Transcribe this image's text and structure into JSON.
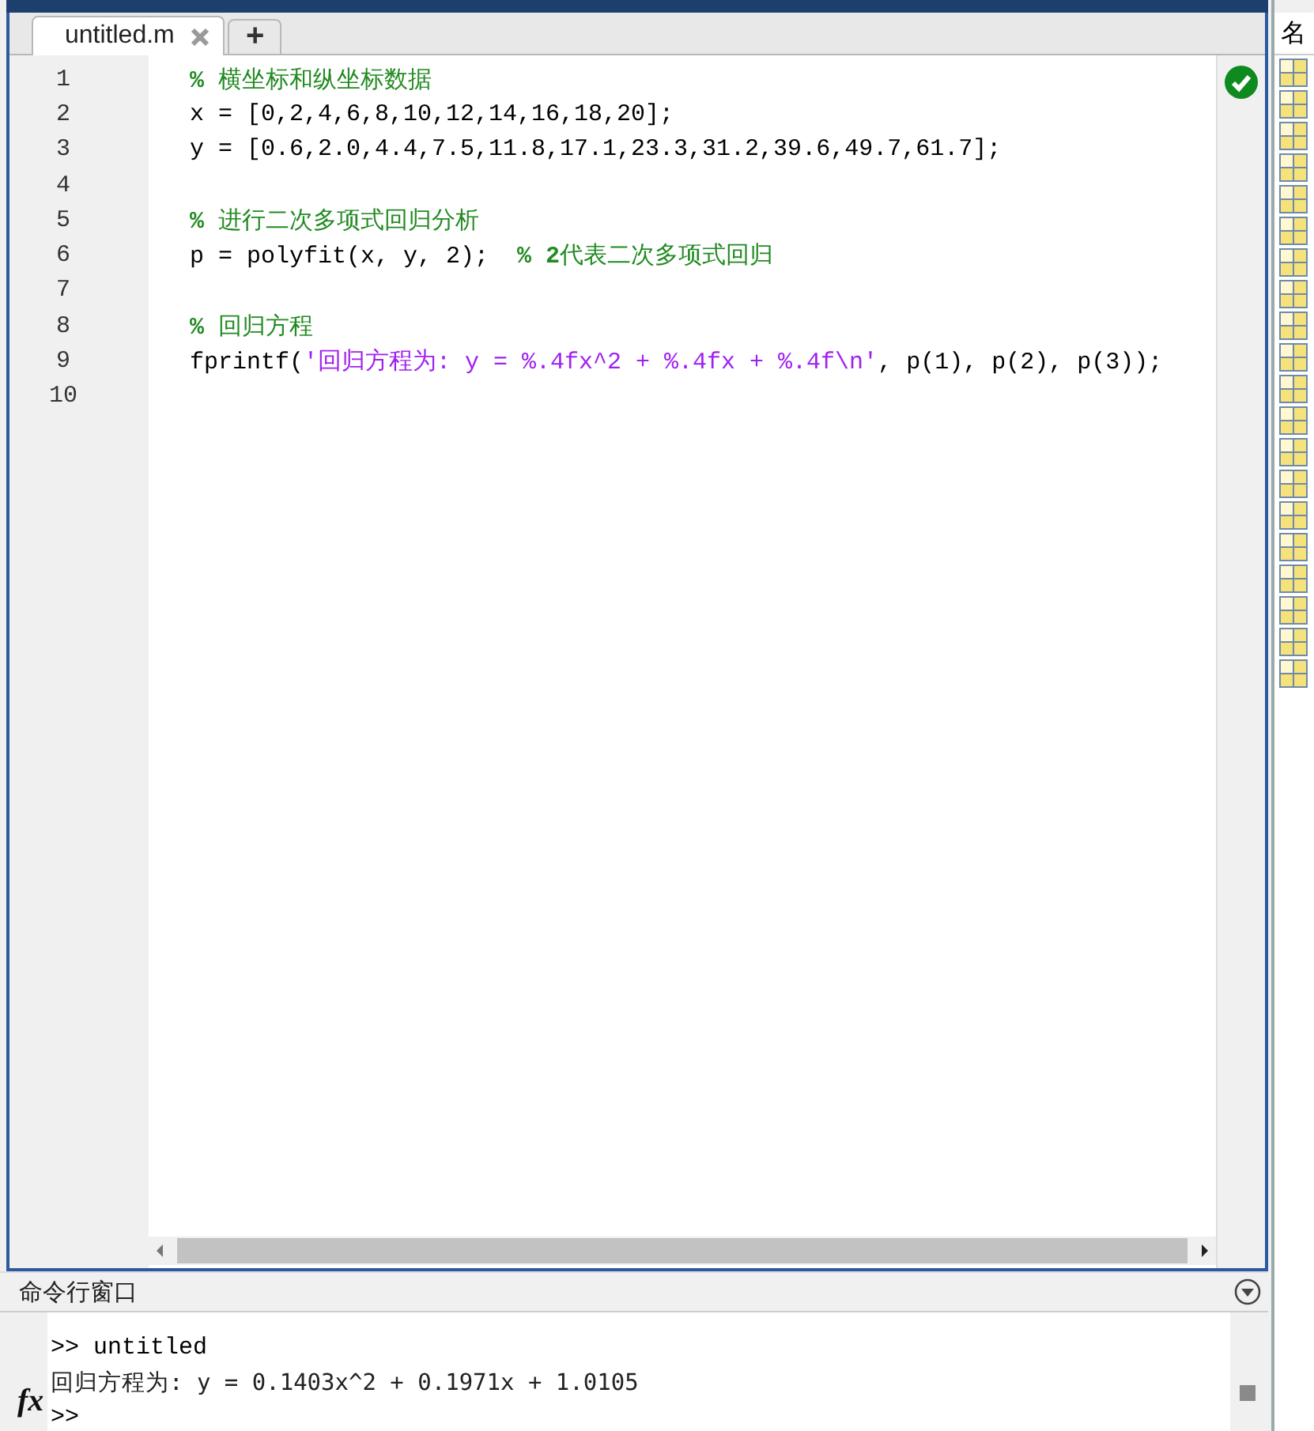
{
  "editor": {
    "tabs": [
      {
        "label": "untitled.m",
        "selected": true
      }
    ],
    "add_tab": "+",
    "no_issues": true,
    "lines": [
      {
        "number": "1",
        "tokens": [
          {
            "kind": "comment",
            "text": "**%** 横坐标和纵坐标数据"
          }
        ]
      },
      {
        "number": "2",
        "tokens": [
          {
            "kind": "code",
            "text": "x = [0,2,4,6,8,10,12,14,16,18,20];"
          }
        ]
      },
      {
        "number": "3",
        "tokens": [
          {
            "kind": "code",
            "text": "y = [0.6,2.0,4.4,7.5,11.8,17.1,23.3,31.2,39.6,49.7,61.7];"
          }
        ]
      },
      {
        "number": "4"
      },
      {
        "number": "5",
        "tokens": [
          {
            "kind": "comment",
            "text": "**%** 进行二次多项式回归分析"
          }
        ]
      },
      {
        "number": "6",
        "tokens": [
          {
            "kind": "code",
            "text": "p = polyfit(x, y, 2);  "
          },
          {
            "kind": "comment",
            "text": "**% 2**代表二次多项式回归"
          }
        ]
      },
      {
        "number": "7"
      },
      {
        "number": "8",
        "tokens": [
          {
            "kind": "comment",
            "text": "**%** 回归方程"
          }
        ]
      },
      {
        "number": "9",
        "tokens": [
          {
            "kind": "code",
            "text": "fprintf("
          },
          {
            "kind": "string",
            "text": "'回归方程为: y = %.4fx^2 + %.4fx + %.4f\\n'"
          },
          {
            "kind": "code",
            "text": ", p(1), p(2), p(3));"
          }
        ]
      },
      {
        "number": "10"
      }
    ]
  },
  "command_window": {
    "title": "命令行窗口",
    "fx_label": "fx",
    "lines": [
      {
        "kind": "input",
        "text": ">> untitled"
      },
      {
        "kind": "output",
        "text": "回归方程为: y = 0.1403x^2 + 0.1971x + 1.0105"
      },
      {
        "kind": "input",
        "text": ">>"
      }
    ]
  },
  "workspace": {
    "header": "名"
  }
}
